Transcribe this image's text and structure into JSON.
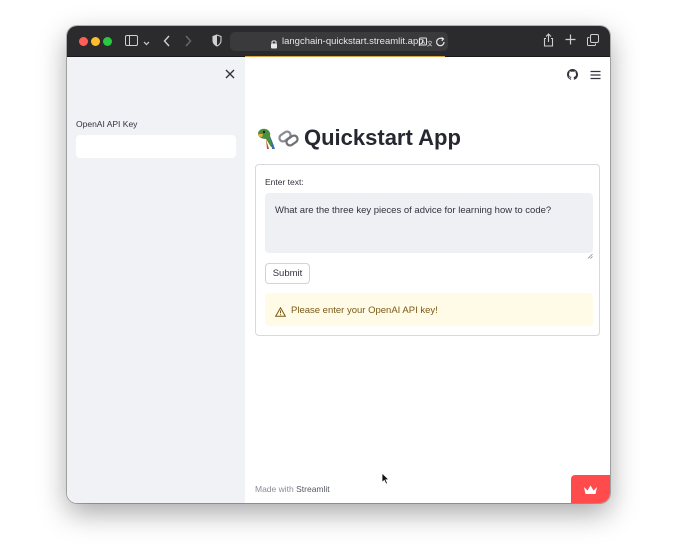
{
  "browser": {
    "url": "langchain-quickstart.streamlit.app",
    "icons": [
      "sidebar-toggle-icon",
      "chevron-left-icon",
      "chevron-right-icon",
      "shield-icon",
      "lock-icon",
      "reader-icon",
      "reload-icon",
      "share-icon",
      "plus-icon",
      "tabs-icon"
    ]
  },
  "sidebar": {
    "api_key_label": "OpenAI API Key",
    "api_key_value": "",
    "background": "#f0f2f6"
  },
  "main": {
    "title_emoji": "🦜🔗",
    "title": "Quickstart App",
    "form": {
      "label": "Enter text:",
      "textarea_value": "What are the three key pieces of advice for learning how to code?",
      "submit_label": "Submit"
    },
    "alert": {
      "text": "Please enter your OpenAI API key!",
      "icon": "warning-icon",
      "background": "#fffbe6"
    },
    "footer": {
      "prefix": "Made with ",
      "brand": "Streamlit"
    }
  },
  "colors": {
    "accent": "#ff4b4b",
    "titlebar": "#2b2b2d"
  }
}
